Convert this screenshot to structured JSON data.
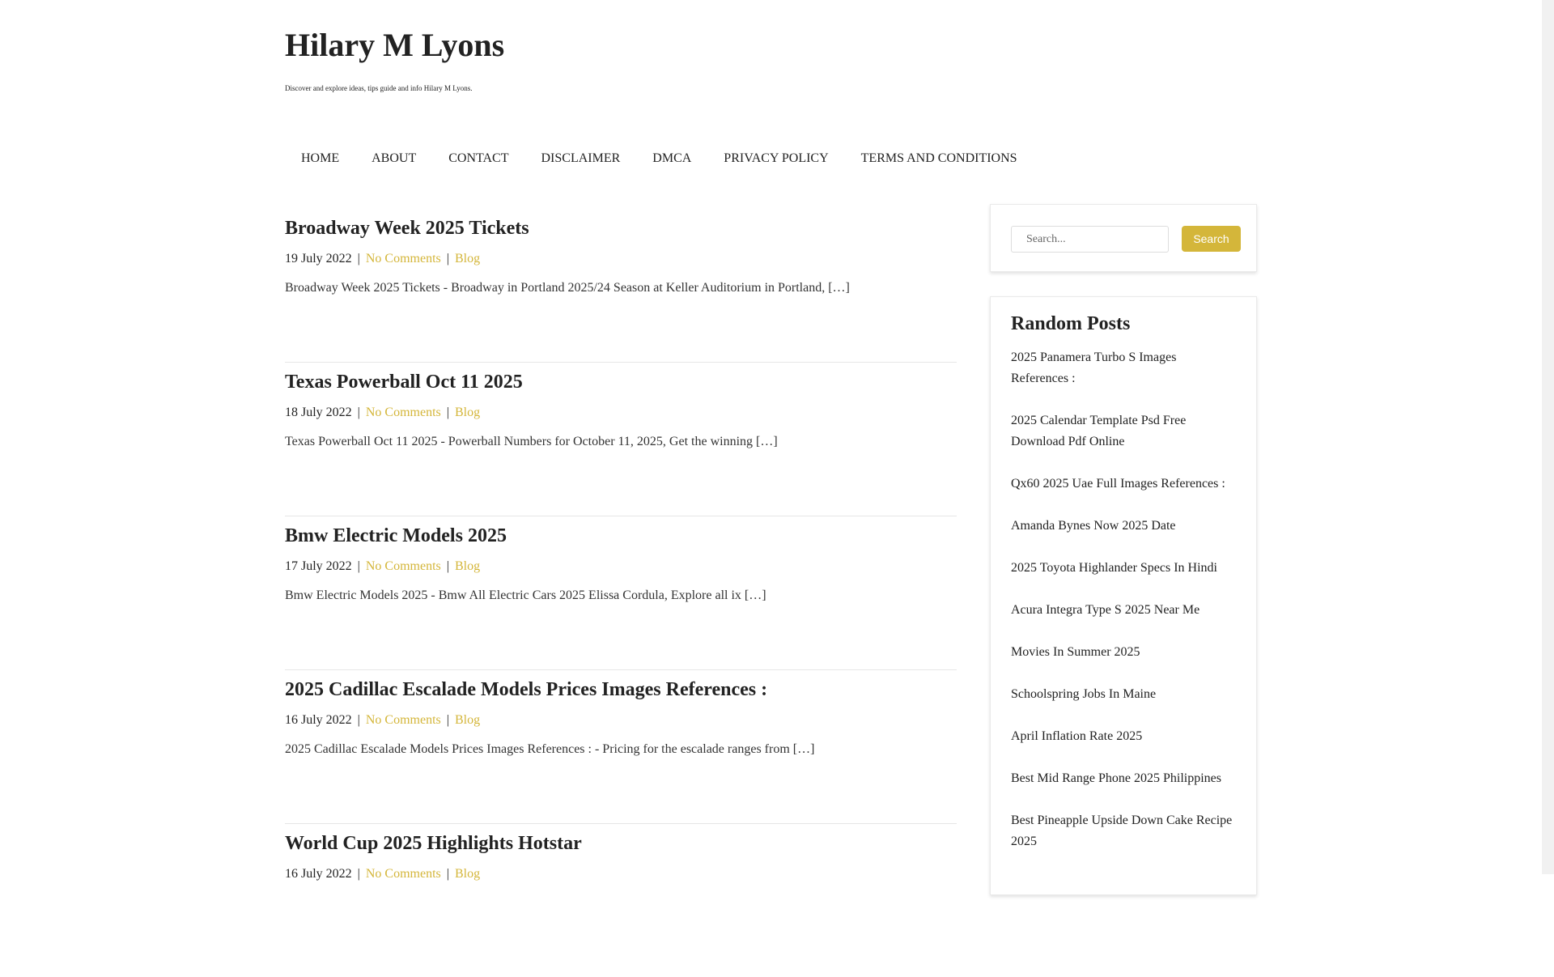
{
  "site": {
    "title": "Hilary M Lyons",
    "description": "Discover and explore ideas, tips guide and info Hilary M Lyons."
  },
  "nav": {
    "items": [
      {
        "label": "HOME"
      },
      {
        "label": "ABOUT"
      },
      {
        "label": "CONTACT"
      },
      {
        "label": "DISCLAIMER"
      },
      {
        "label": "DMCA"
      },
      {
        "label": "PRIVACY POLICY"
      },
      {
        "label": "TERMS AND CONDITIONS"
      }
    ]
  },
  "posts": [
    {
      "title": "Broadway Week 2025 Tickets",
      "date": "19 July 2022",
      "comments": "No Comments",
      "category": "Blog",
      "excerpt": "Broadway Week 2025 Tickets - Broadway in Portland 2025/24 Season at Keller Auditorium in Portland, […]"
    },
    {
      "title": "Texas Powerball Oct 11 2025",
      "date": "18 July 2022",
      "comments": "No Comments",
      "category": "Blog",
      "excerpt": "Texas Powerball Oct 11 2025 - Powerball Numbers for October 11, 2025, Get the winning […]"
    },
    {
      "title": "Bmw Electric Models 2025",
      "date": "17 July 2022",
      "comments": "No Comments",
      "category": "Blog",
      "excerpt": "Bmw Electric Models 2025 - Bmw All Electric Cars 2025 Elissa Cordula, Explore all ix […]"
    },
    {
      "title": "2025 Cadillac Escalade Models Prices Images References :",
      "date": "16 July 2022",
      "comments": "No Comments",
      "category": "Blog",
      "excerpt": "2025 Cadillac Escalade Models Prices Images References : - Pricing for the escalade ranges from […]"
    },
    {
      "title": "World Cup 2025 Highlights Hotstar",
      "date": "16 July 2022",
      "comments": "No Comments",
      "category": "Blog",
      "excerpt": ""
    }
  ],
  "meta_separator": "|",
  "search": {
    "placeholder": "Search...",
    "button_label": "Search"
  },
  "random_posts": {
    "title": "Random Posts",
    "items": [
      "2025 Panamera Turbo S Images References :",
      "2025 Calendar Template Psd Free Download Pdf Online",
      "Qx60 2025 Uae Full Images References :",
      "Amanda Bynes Now 2025 Date",
      "2025 Toyota Highlander Specs In Hindi",
      "Acura Integra Type S 2025 Near Me",
      "Movies In Summer 2025",
      "Schoolspring Jobs In Maine",
      "April Inflation Rate 2025",
      "Best Mid Range Phone 2025 Philippines",
      "Best Pineapple Upside Down Cake Recipe 2025"
    ]
  },
  "colors": {
    "accent": "#d4b63a",
    "text": "#222222"
  }
}
